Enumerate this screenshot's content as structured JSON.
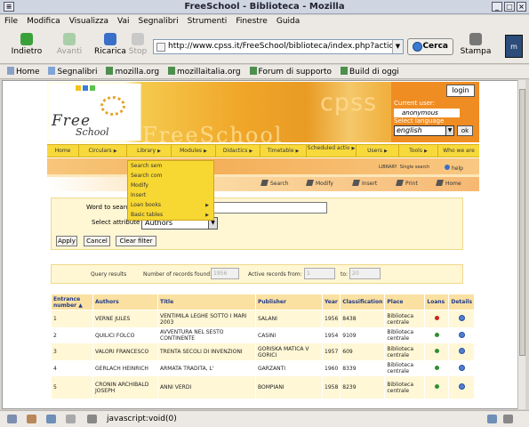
{
  "window": {
    "title": "FreeSchool - Biblioteca - Mozilla"
  },
  "menu": [
    "File",
    "Modifica",
    "Visualizza",
    "Vai",
    "Segnalibri",
    "Strumenti",
    "Finestre",
    "Guida"
  ],
  "nav": {
    "back": "Indietro",
    "forward": "Avanti",
    "reload": "Ricarica",
    "stop": "Stop",
    "url": "http://www.cpss.it/FreeSchool/biblioteca/index.php?action=bib_s",
    "go": "Cerca",
    "print": "Stampa"
  },
  "bookmarks": [
    "Home",
    "Segnalibri",
    "mozilla.org",
    "mozillaitalia.org",
    "Forum di supporto",
    "Build di oggi"
  ],
  "banner": {
    "logo_main": "Free",
    "logo_sub": "School",
    "brand_big": "FreeSchool",
    "brand_cpss": "cpss"
  },
  "login": {
    "button": "login",
    "current_user_label": "Current user:",
    "current_user": "anonymous",
    "select_language_label": "Select language",
    "language": "english",
    "ok": "ok"
  },
  "topnav": [
    {
      "label": "Home",
      "arrow": ""
    },
    {
      "label": "Circulars",
      "arrow": "▶"
    },
    {
      "label": "Library",
      "arrow": "▶"
    },
    {
      "label": "Modules",
      "arrow": "▶"
    },
    {
      "label": "Didactics",
      "arrow": "▶"
    },
    {
      "label": "Timetable",
      "arrow": "▶"
    },
    {
      "label": "Scheduled activ",
      "arrow": "▶"
    },
    {
      "label": "Users",
      "arrow": "▶"
    },
    {
      "label": "Tools",
      "arrow": "▶"
    },
    {
      "label": "Who we are",
      "arrow": ""
    }
  ],
  "library_dropdown": [
    {
      "label": "Search sem",
      "arrow": ""
    },
    {
      "label": "Search com",
      "arrow": ""
    },
    {
      "label": "Modify",
      "arrow": ""
    },
    {
      "label": "Insert",
      "arrow": ""
    },
    {
      "label": "Loan books",
      "arrow": "▶"
    },
    {
      "label": "Basic tables",
      "arrow": "▶"
    }
  ],
  "breadcrumb": {
    "section": "LIBRARY",
    "page": "Single search",
    "help": "help"
  },
  "actions": [
    "Search",
    "Modify",
    "Insert",
    "Print",
    "Home"
  ],
  "form": {
    "word_label": "Word to search",
    "attr_label": "Select attribute",
    "attr_value": "Authors",
    "apply": "Apply",
    "cancel": "Cancel",
    "clear": "Clear filter"
  },
  "query": {
    "label": "Query results",
    "found_label": "Number of records found:",
    "found_value": "1956",
    "active_label": "Active records from:",
    "active_from": "1",
    "to_label": "to:",
    "active_to": "20"
  },
  "table": {
    "headers": [
      "Entrance number ▲",
      "Authors",
      "Title",
      "Publisher",
      "Year",
      "Classification",
      "Place",
      "Loans",
      "Details"
    ],
    "rows": [
      {
        "n": "1",
        "author": "VERNE JULES",
        "title": "VENTIMILA LEGHE SOTTO I MARI 2003",
        "publisher": "SALANI",
        "year": "1956",
        "cls": "8438",
        "place": "Biblioteca centrale",
        "loan": "#cc2222"
      },
      {
        "n": "2",
        "author": "QUILICI FOLCO",
        "title": "AVVENTURA NEL SESTO CONTINENTE",
        "publisher": "CASINI",
        "year": "1954",
        "cls": "9109",
        "place": "Biblioteca centrale",
        "loan": "#2f8f2f"
      },
      {
        "n": "3",
        "author": "VALORI FRANCESCO",
        "title": "TRENTA SECOLI DI INVENZIONI",
        "publisher": "GORISKA MATICA V GORICI",
        "year": "1957",
        "cls": "609",
        "place": "Biblioteca centrale",
        "loan": "#2f8f2f"
      },
      {
        "n": "4",
        "author": "GERLACH HEINRICH",
        "title": "ARMATA TRADITA, L'",
        "publisher": "GARZANTI",
        "year": "1960",
        "cls": "8339",
        "place": "Biblioteca centrale",
        "loan": "#2f8f2f"
      },
      {
        "n": "5",
        "author": "CRONIN ARCHIBALD JOSEPH",
        "title": "ANNI VERDI",
        "publisher": "BOMPIANI",
        "year": "1958",
        "cls": "8239",
        "place": "Biblioteca centrale",
        "loan": "#2f8f2f"
      }
    ]
  },
  "status": {
    "text": "javascript:void(0)"
  }
}
